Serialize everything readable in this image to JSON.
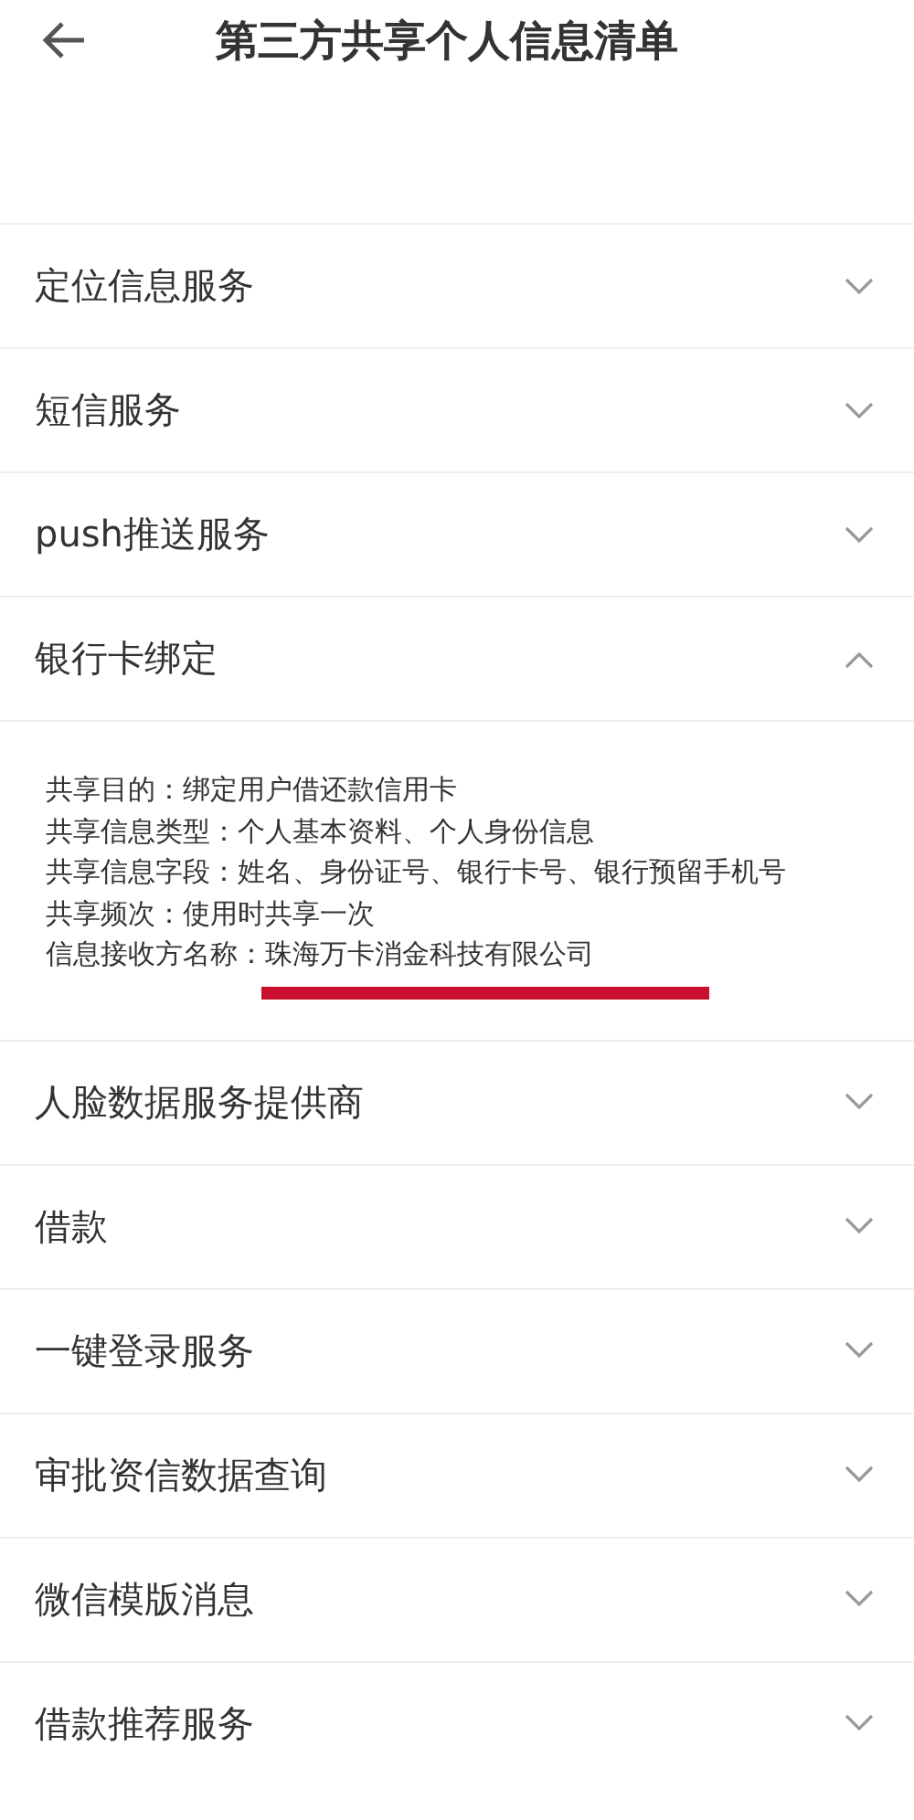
{
  "header": {
    "title": "第三方共享个人信息清单"
  },
  "items": [
    {
      "label": "定位信息服务",
      "expanded": false
    },
    {
      "label": "短信服务",
      "expanded": false
    },
    {
      "label": "push推送服务",
      "expanded": false
    },
    {
      "label": "银行卡绑定",
      "expanded": true,
      "details": [
        {
          "text": "共享目的：绑定用户借还款信用卡",
          "underlined": false
        },
        {
          "text": "共享信息类型：个人基本资料、个人身份信息",
          "underlined": false
        },
        {
          "text": "共享信息字段：姓名、身份证号、银行卡号、银行预留手机号",
          "underlined": false
        },
        {
          "text": "共享频次：使用时共享一次",
          "underlined": false
        },
        {
          "text": "信息接收方名称：珠海万卡消金科技有限公司",
          "underlined": true
        }
      ]
    },
    {
      "label": "人脸数据服务提供商",
      "expanded": false
    },
    {
      "label": "借款",
      "expanded": false
    },
    {
      "label": "一键登录服务",
      "expanded": false
    },
    {
      "label": "审批资信数据查询",
      "expanded": false
    },
    {
      "label": "微信模版消息",
      "expanded": false
    },
    {
      "label": "借款推荐服务",
      "expanded": false
    }
  ]
}
